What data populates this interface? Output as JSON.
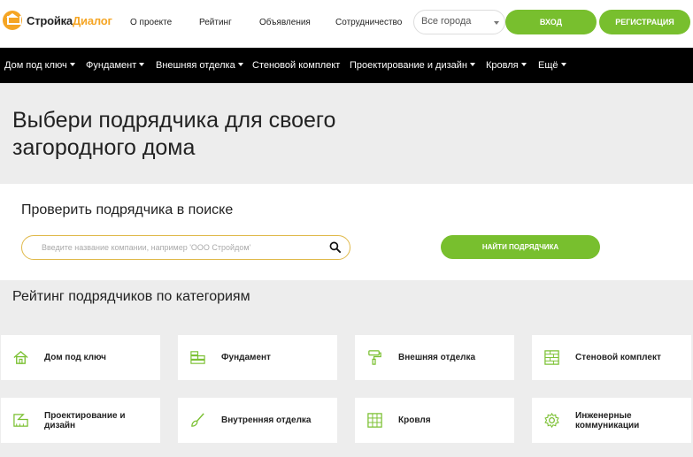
{
  "header": {
    "logo_part1": "Стройка",
    "logo_part2": "Диалог",
    "links": [
      "О проекте",
      "Рейтинг",
      "Объявления",
      "Сотрудничество"
    ],
    "city_select": "Все города",
    "login_label": "ВХОД",
    "register_label": "РЕГИСТРАЦИЯ"
  },
  "nav": {
    "items": [
      "Дом под ключ",
      "Фундамент",
      "Внешняя отделка",
      "Стеновой комплект",
      "Проектирование и дизайн",
      "Кровля",
      "Ещё"
    ]
  },
  "hero": {
    "title_line1": "Выбери подрядчика для своего",
    "title_line2": "загородного дома"
  },
  "search": {
    "heading": "Проверить подрядчика в поиске",
    "placeholder": "Введите название компании, например 'ООО Стройдом'",
    "button_label": "НАЙТИ ПОДРЯДЧИКА"
  },
  "ratings": {
    "title": "Рейтинг подрядчиков по категориям",
    "categories": [
      {
        "label": "Дом под ключ",
        "icon": "house-icon"
      },
      {
        "label": "Фундамент",
        "icon": "bricks-icon"
      },
      {
        "label": "Внешняя отделка",
        "icon": "paint-roller-icon"
      },
      {
        "label": "Стеновой комплект",
        "icon": "wall-icon"
      },
      {
        "label": "Проектирование и дизайн",
        "icon": "ruler-icon"
      },
      {
        "label": "Внутренняя отделка",
        "icon": "brush-icon"
      },
      {
        "label": "Кровля",
        "icon": "roof-tiles-icon"
      },
      {
        "label": "Инженерные коммуникации",
        "icon": "gear-icon"
      }
    ]
  },
  "colors": {
    "accent": "#78bf2e",
    "logo": "#f5a524",
    "nav_bg": "#000000"
  }
}
